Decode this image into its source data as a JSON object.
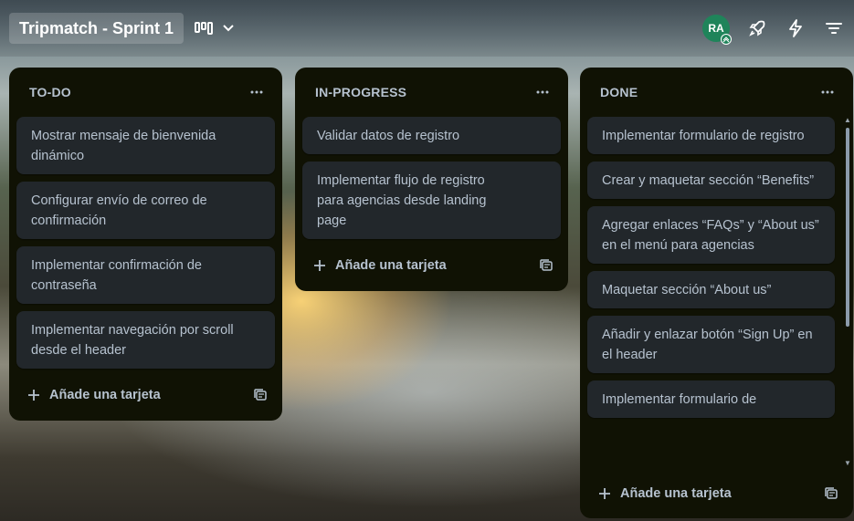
{
  "board": {
    "title": "Tripmatch - Sprint 1"
  },
  "header": {
    "avatar_initials": "RA"
  },
  "lists": [
    {
      "title": "TO-DO",
      "cards": [
        "Mostrar mensaje de bienvenida dinámico",
        "Configurar envío de correo de confirmación",
        "Implementar confirmación de contraseña",
        "Implementar navegación por scroll desde el header"
      ],
      "add_label": "Añade una tarjeta"
    },
    {
      "title": "IN-PROGRESS",
      "cards": [
        "Validar datos de registro",
        "Implementar flujo de registro para agencias desde landing page"
      ],
      "add_label": "Añade una tarjeta"
    },
    {
      "title": "DONE",
      "cards": [
        "Implementar formulario de registro",
        "Crear y maquetar sección “Benefits”",
        "Agregar enlaces “FAQs” y “About us” en el menú para agencias",
        "Maquetar sección “About us”",
        "Añadir y enlazar botón “Sign Up” en el header",
        "Implementar formulario de"
      ],
      "add_label": "Añade una tarjeta"
    }
  ],
  "colors": {
    "list_bg": "#101204",
    "card_bg": "#22272b",
    "text": "#b6c2cf",
    "avatar": "#1f845a"
  }
}
